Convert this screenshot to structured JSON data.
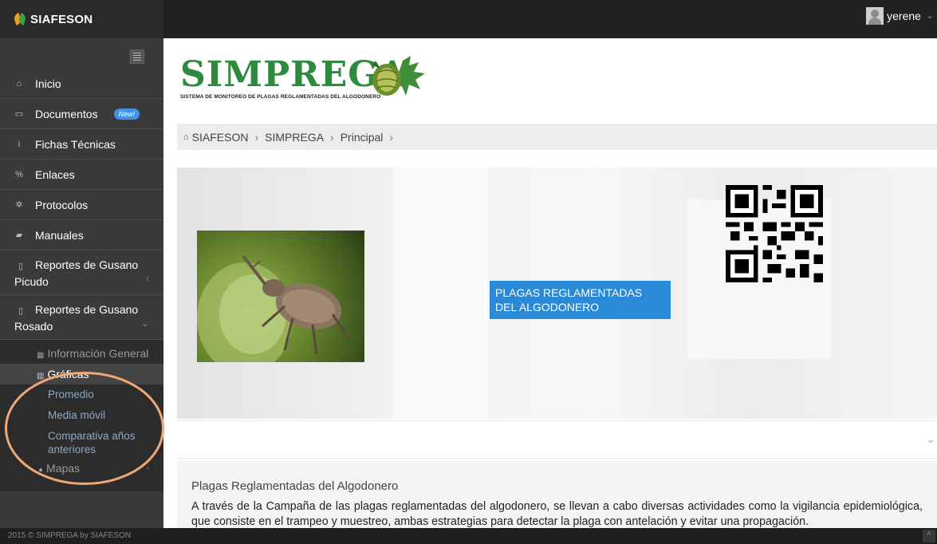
{
  "topbar": {
    "brand": "SIAFESON",
    "user_name": "yerene"
  },
  "sidebar": {
    "items": [
      {
        "label": "Inicio",
        "icon": "home-icon"
      },
      {
        "label": "Documentos",
        "icon": "folder-icon",
        "badge": "New!"
      },
      {
        "label": "Fichas Técnicas",
        "icon": "info-icon"
      },
      {
        "label": "Enlaces",
        "icon": "link-icon"
      },
      {
        "label": "Protocolos",
        "icon": "gear-icon"
      },
      {
        "label": "Manuales",
        "icon": "book-icon"
      },
      {
        "label": "Reportes de Gusano Picudo",
        "icon": "file-icon"
      },
      {
        "label": "Reportes de Gusano Rosado",
        "icon": "file-icon"
      }
    ],
    "submenu": {
      "info_general": "Información General",
      "graficas": "Gráficas",
      "promedio": "Promedio",
      "media_movil": "Media móvil",
      "comparativa": "Comparativa años anteriores",
      "mapas": "Mapas"
    }
  },
  "logo": {
    "title": "SIMPREGA",
    "subtitle": "SISTEMA DE MONITOREO DE PLAGAS REGLAMENTADAS DEL ALGODONERO"
  },
  "breadcrumb": [
    "SIAFESON",
    "SIMPREGA",
    "Principal"
  ],
  "banner": {
    "label": "PLAGAS REGLAMENTADAS DEL ALGODONERO"
  },
  "info": {
    "title": "Plagas Reglamentadas del Algodonero",
    "text": "A través de la Campaña de las plagas reglamentadas del algodonero, se llevan a cabo diversas actividades como la vigilancia epidemiológica, que consiste en el trampeo y muestreo, ambas estrategias para detectar la plaga con antelación y evitar una propagación."
  },
  "footer": {
    "text": "2015 © SIMPREGA by SIAFESON"
  },
  "colors": {
    "topbar": "#222222",
    "sidebar": "#3a3a3a",
    "accent_blue": "#2a8ad8",
    "logo_green": "#2d8a3e",
    "highlight": "#f0a875"
  }
}
